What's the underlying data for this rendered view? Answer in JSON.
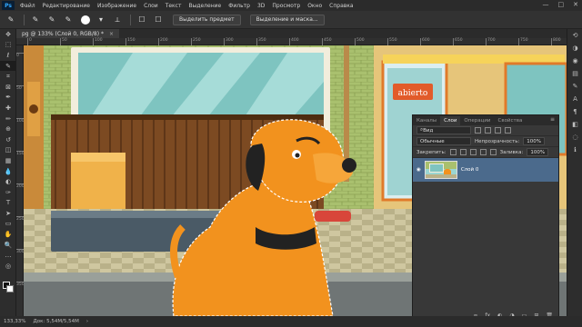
{
  "menu": {
    "logo": "Ps",
    "items": [
      "Файл",
      "Редактирование",
      "Изображение",
      "Слои",
      "Текст",
      "Выделение",
      "Фильтр",
      "3D",
      "Просмотр",
      "Окно",
      "Справка"
    ],
    "window_buttons": [
      "—",
      "□",
      "✕"
    ]
  },
  "options": {
    "select_subject": "Выделить предмет",
    "select_and_mask": "Выделение и маска..."
  },
  "document": {
    "tab_title": "pg @ 133% (Слой 0, RGB/8) *",
    "tab_close": "×"
  },
  "tools": [
    "move-icon",
    "marquee-icon",
    "lasso-icon",
    "quick-select-icon",
    "crop-icon",
    "frame-icon",
    "eyedropper-icon",
    "healing-icon",
    "brush-icon",
    "stamp-icon",
    "history-brush-icon",
    "eraser-icon",
    "gradient-icon",
    "blur-icon",
    "dodge-icon",
    "pen-icon",
    "type-icon",
    "path-select-icon",
    "shape-icon",
    "hand-icon",
    "zoom-icon",
    "more-icon",
    "quickmask-icon"
  ],
  "tool_glyphs": [
    "✥",
    "⬚",
    "ℓ",
    "✎",
    "⌗",
    "⊠",
    "✒",
    "✚",
    "✏",
    "⊕",
    "↺",
    "◫",
    "▦",
    "💧",
    "◐",
    "✑",
    "T",
    "➤",
    "▭",
    "✋",
    "🔍",
    "…",
    "◎"
  ],
  "right_icons": [
    "history-icon",
    "adjust-icon",
    "color-icon",
    "swatches-icon",
    "brush-settings-icon",
    "character-icon",
    "paragraph-icon",
    "channels-icon",
    "paths-icon",
    "info-icon"
  ],
  "right_glyphs": [
    "⟲",
    "◑",
    "◉",
    "▤",
    "✎",
    "A",
    "¶",
    "◧",
    "◌",
    "ℹ"
  ],
  "ruler": {
    "h_ticks": [
      "0",
      "50",
      "100",
      "150",
      "200",
      "250",
      "300",
      "350",
      "400",
      "450",
      "500",
      "550",
      "600",
      "650",
      "700",
      "750",
      "800"
    ],
    "v_ticks": [
      "0",
      "50",
      "100",
      "150",
      "200",
      "250",
      "300",
      "350"
    ]
  },
  "canvas": {
    "shop_sign": "abierto"
  },
  "layers_panel": {
    "tabs": [
      "Каналы",
      "Слои",
      "Операции",
      "Свойства"
    ],
    "active_tab": "Слои",
    "menu_glyph": "≡",
    "filter_label": "Вид",
    "blend_mode": "Обычные",
    "opacity_label": "Непрозрачность:",
    "opacity_value": "100%",
    "lock_label": "Закрепить:",
    "fill_label": "Заливка:",
    "fill_value": "100%",
    "layer_name": "Слой 0",
    "footer_icons": [
      "∞",
      "fx",
      "◐",
      "◑",
      "▭",
      "⊞",
      "🗑"
    ]
  },
  "status": {
    "zoom": "133,33%",
    "doc_size": "Док: 5,54M/5,54M",
    "arrow": "›"
  },
  "colors": {
    "accent": "#31a8ff",
    "selected_layer": "#4b6a8c"
  }
}
